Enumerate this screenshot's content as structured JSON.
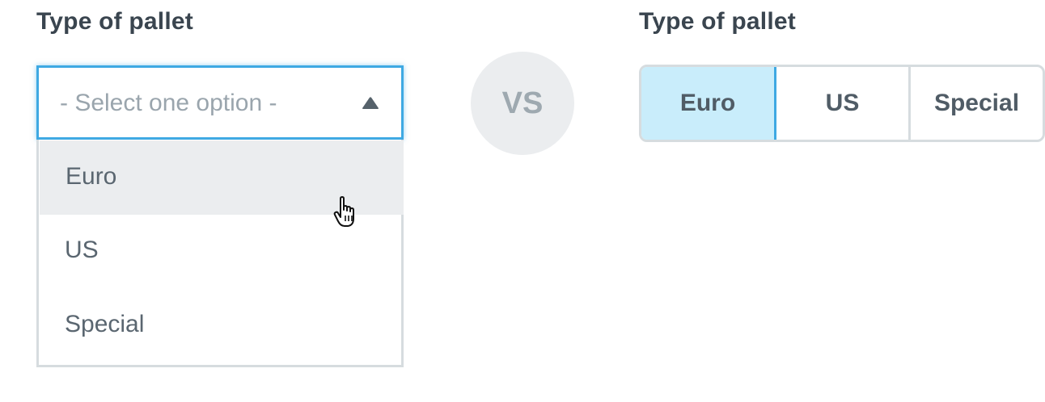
{
  "left": {
    "label": "Type of pallet",
    "select": {
      "placeholder": "- Select one option -",
      "caret_icon": "caret-up-icon",
      "options": [
        "Euro",
        "US",
        "Special"
      ],
      "hovered_option": "Euro"
    }
  },
  "vs": "VS",
  "right": {
    "label": "Type of pallet",
    "segments": [
      "Euro",
      "US",
      "Special"
    ],
    "selected": "Euro"
  },
  "colors": {
    "accent": "#3fa9e3",
    "selected_fill": "#c9edfb",
    "hover_fill": "#ebedef",
    "border": "#d6dcdf"
  }
}
